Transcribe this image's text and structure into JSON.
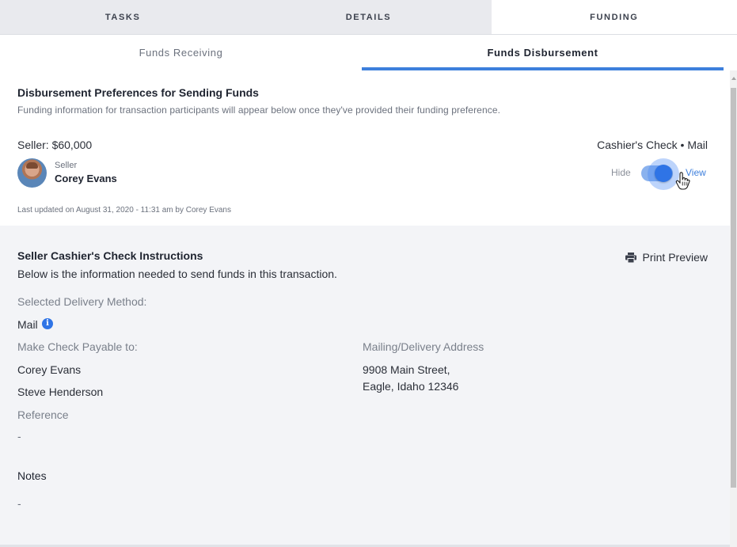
{
  "top_tabs": [
    {
      "label": "TASKS",
      "active": false
    },
    {
      "label": "DETAILS",
      "active": false
    },
    {
      "label": "FUNDING",
      "active": true
    }
  ],
  "sub_tabs": [
    {
      "label": "Funds Receiving",
      "active": false
    },
    {
      "label": "Funds Disbursement",
      "active": true
    }
  ],
  "preferences": {
    "title": "Disbursement Preferences for Sending Funds",
    "subtitle": "Funding information for transaction participants will appear below once they've provided their funding preference.",
    "seller_amount": "Seller: $60,000",
    "method": "Cashier's Check • Mail",
    "role": "Seller",
    "name": "Corey Evans",
    "hide_label": "Hide",
    "view_label": "View",
    "toggle_on": true,
    "last_updated": "Last updated on August 31, 2020 - 11:31 am by Corey Evans"
  },
  "instructions": {
    "title": "Seller Cashier's Check Instructions",
    "subtitle": "Below is the information needed to send funds in this transaction.",
    "print_label": "Print Preview",
    "delivery_method_label": "Selected Delivery Method:",
    "delivery_method_value": "Mail",
    "payable_label": "Make Check Payable to:",
    "payees": [
      "Corey Evans",
      "Steve Henderson"
    ],
    "address_label": "Mailing/Delivery Address",
    "address_line1": "9908 Main Street,",
    "address_line2": "Eagle, Idaho 12346",
    "reference_label": "Reference",
    "reference_value": "-",
    "notes_label": "Notes",
    "notes_value": "-"
  },
  "colors": {
    "accent": "#3d7fdc",
    "toggle_knob": "#2f74e6",
    "section_bg": "#f3f4f7"
  }
}
